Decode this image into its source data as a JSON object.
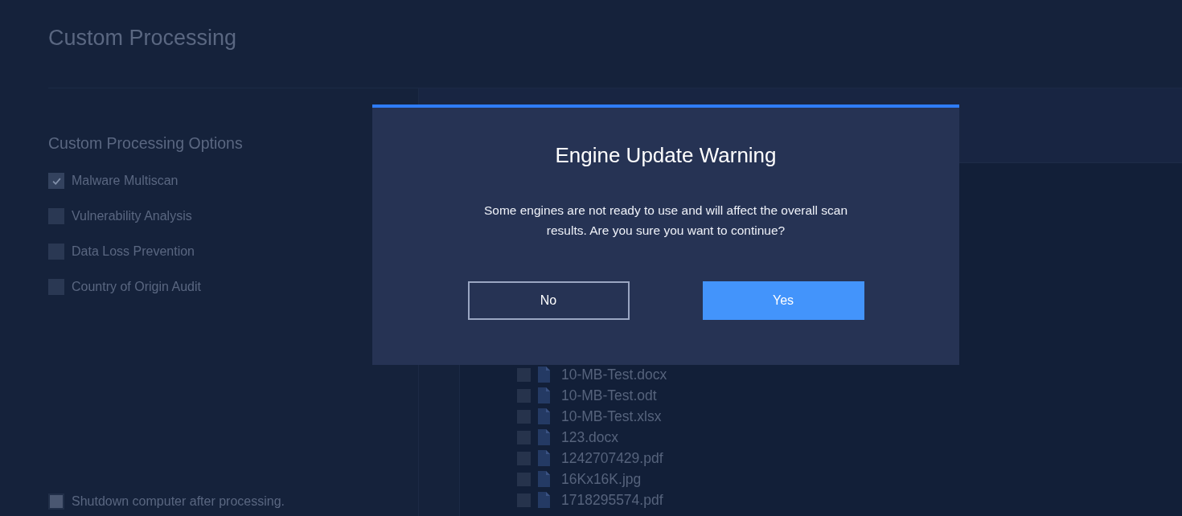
{
  "page": {
    "title": "Custom Processing"
  },
  "options": {
    "heading": "Custom Processing Options",
    "items": [
      {
        "label": "Malware Multiscan",
        "checked": true
      },
      {
        "label": "Vulnerability Analysis",
        "checked": false
      },
      {
        "label": "Data Loss Prevention",
        "checked": false
      },
      {
        "label": "Country of Origin Audit",
        "checked": false
      }
    ]
  },
  "shutdown": {
    "label": "Shutdown computer after processing.",
    "checked": false
  },
  "files": [
    {
      "name": "10-MB-Test.docx",
      "checked": false
    },
    {
      "name": "10-MB-Test.odt",
      "checked": false
    },
    {
      "name": "10-MB-Test.xlsx",
      "checked": false
    },
    {
      "name": "123.docx",
      "checked": false
    },
    {
      "name": "1242707429.pdf",
      "checked": false
    },
    {
      "name": "16Kx16K.jpg",
      "checked": false
    },
    {
      "name": "1718295574.pdf",
      "checked": false
    }
  ],
  "dialog": {
    "title": "Engine Update Warning",
    "message": "Some engines are not ready to use and will affect the overall scan results. Are you sure you want to continue?",
    "buttons": [
      {
        "label": "No",
        "kind": "secondary"
      },
      {
        "label": "Yes",
        "kind": "primary"
      }
    ]
  }
}
